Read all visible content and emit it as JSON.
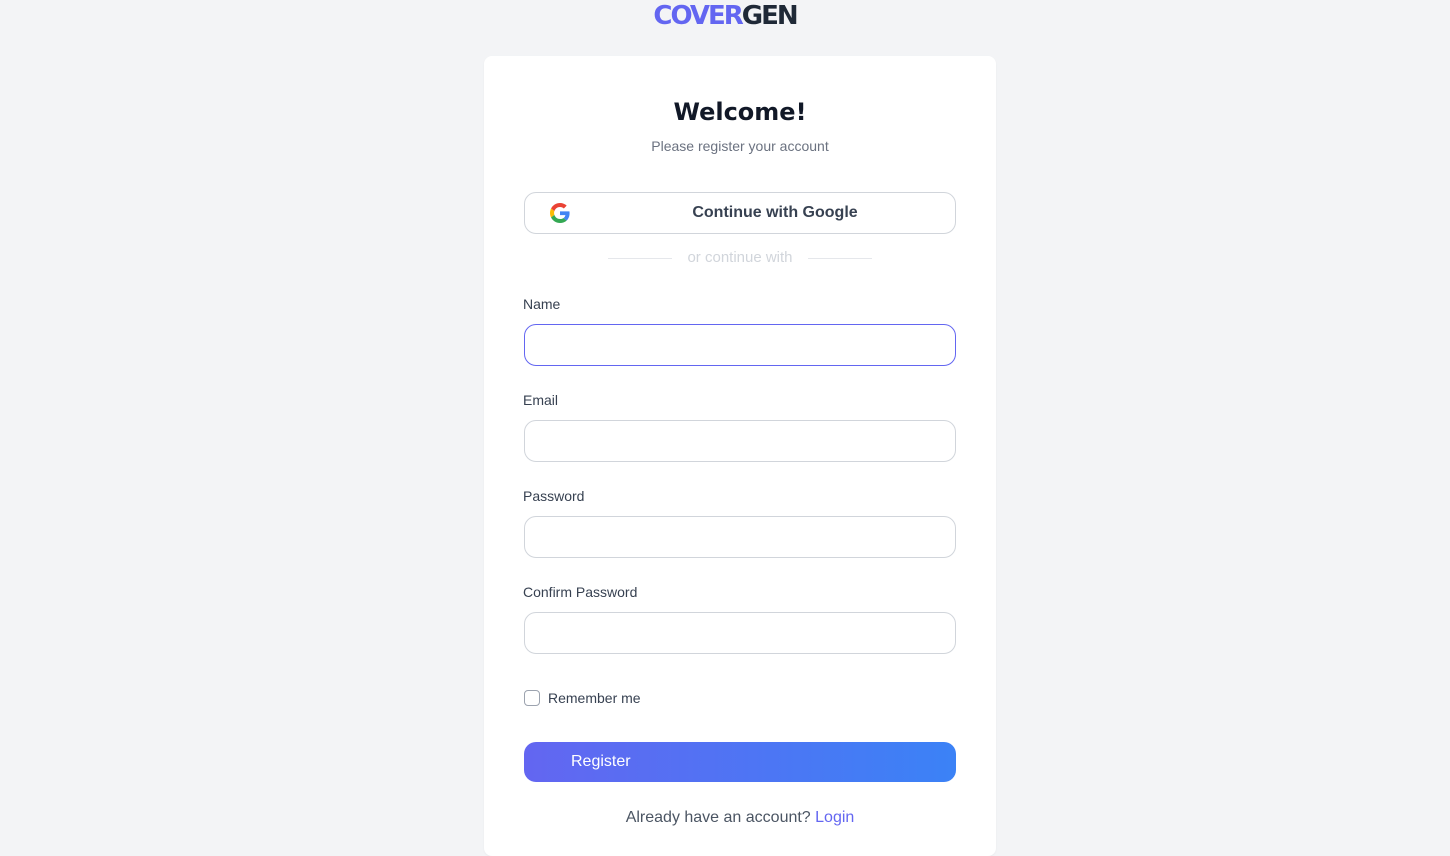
{
  "brand": {
    "part1": "COVER",
    "part2": "GEN"
  },
  "card": {
    "title": "Welcome!",
    "subtitle": "Please register your account"
  },
  "google": {
    "label": "Continue with Google",
    "icon": "google-icon"
  },
  "divider": {
    "text": "or continue with"
  },
  "fields": {
    "name": {
      "label": "Name",
      "value": ""
    },
    "email": {
      "label": "Email",
      "value": ""
    },
    "password": {
      "label": "Password",
      "value": ""
    },
    "confirm_password": {
      "label": "Confirm Password",
      "value": ""
    }
  },
  "remember": {
    "label": "Remember me",
    "checked": false
  },
  "register": {
    "label": "Register"
  },
  "footer": {
    "prompt": "Already have an account? ",
    "link": "Login"
  },
  "colors": {
    "accent": "#6366f1",
    "accent_end": "#3b82f6",
    "background": "#f3f4f6"
  }
}
